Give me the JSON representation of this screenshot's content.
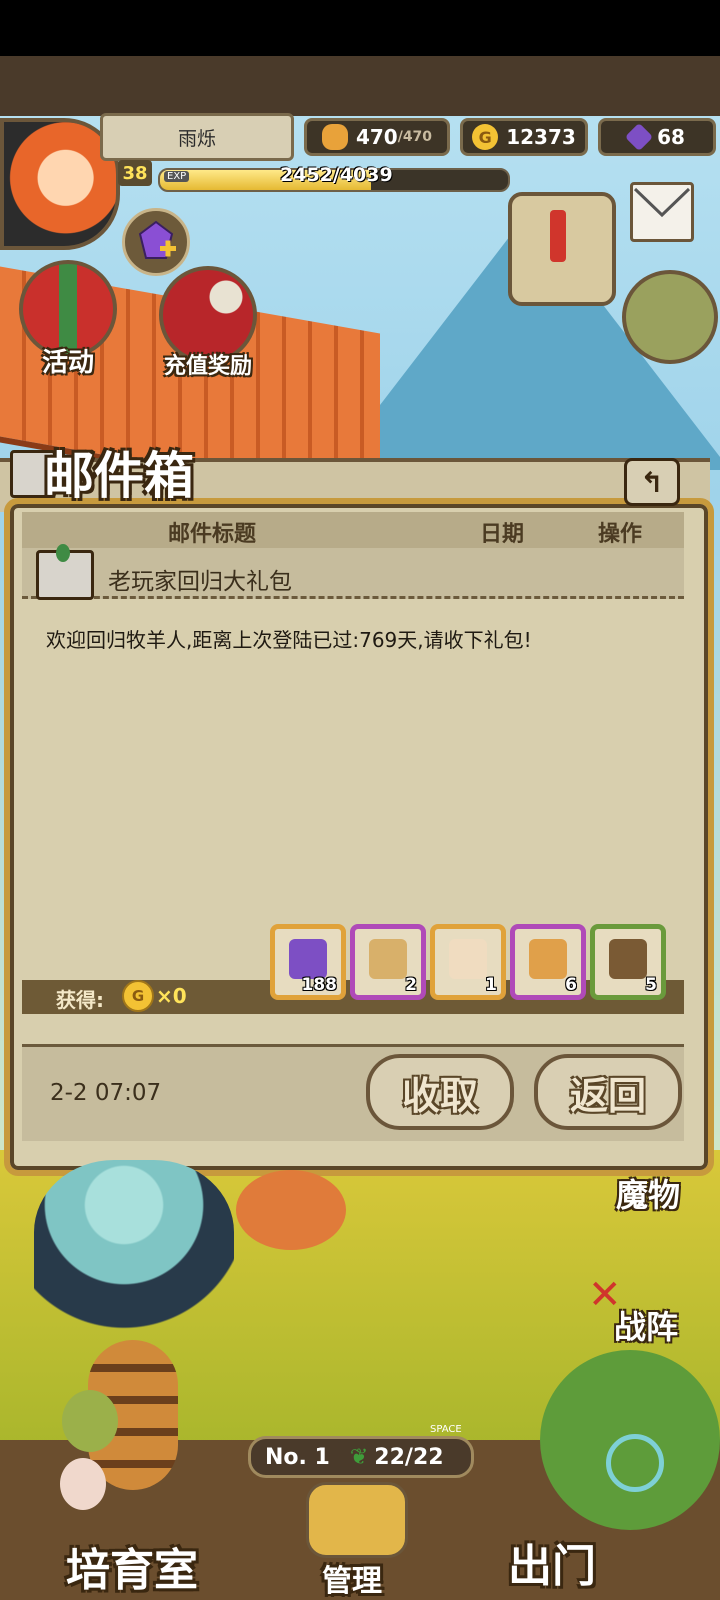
{
  "player": {
    "name": "雨烁",
    "level": "38",
    "exp_label": "EXP",
    "exp_text": "2452/4039",
    "exp_fraction": 0.607
  },
  "resources": {
    "bread_value": "470",
    "bread_max": "/470",
    "gold": "12373",
    "gems": "68",
    "gold_symbol": "G"
  },
  "hud_buttons": {
    "activity": "活动",
    "recharge_reward": "充值奖励"
  },
  "mailbox": {
    "title": "邮件箱",
    "back_symbol": "↰",
    "columns": [
      "邮件标题",
      "日期",
      "操作"
    ],
    "subject": "老玩家回归大礼包",
    "body": "欢迎回归牧羊人,距离上次登陆已过:769天,请收下礼包!",
    "obtain_label": "获得:",
    "gold_reward": "×0",
    "items": [
      {
        "name": "gem",
        "count": "188",
        "border": "#e0a23a",
        "color": "#7d4fc4"
      },
      {
        "name": "gold-bag",
        "count": "2",
        "border": "#b04ab8",
        "color": "#d8b06a"
      },
      {
        "name": "ticket",
        "count": "1",
        "border": "#e0a23a",
        "color": "#f0dcc0"
      },
      {
        "name": "bread-basket",
        "count": "6",
        "border": "#b04ab8",
        "color": "#e0a04a"
      },
      {
        "name": "pickaxe",
        "count": "5",
        "border": "#6a9a3c",
        "color": "#7a5a34"
      }
    ],
    "date": "2-2 07:07",
    "claim_label": "收取",
    "return_label": "返回"
  },
  "scene": {
    "monster_label": "魔物",
    "formation_label": "战阵",
    "rank": "No. 1",
    "space_tag": "SPACE",
    "space_count": "22/22",
    "incubator_label": "培育室",
    "manage_label": "管理",
    "depart_label": "出门"
  }
}
